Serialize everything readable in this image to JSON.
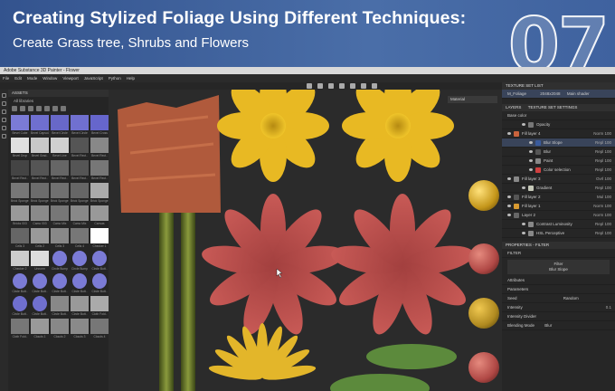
{
  "banner": {
    "title": "Creating Stylized Foliage Using Different Techniques:",
    "subtitle": "Create Grass tree, Shrubs and Flowers",
    "number": "07"
  },
  "window": {
    "title": "Adobe Substance 3D Painter - Flower"
  },
  "menu": [
    "File",
    "Edit",
    "Mode",
    "Window",
    "Viewport",
    "JavaScript",
    "Python",
    "Help"
  ],
  "assets": {
    "header": "ASSETS",
    "filter": "All libraries",
    "items": [
      "Bevel Cube",
      "Bevel Capsul..",
      "Bevel Circle",
      "Bevel Circle",
      "Bevel Cross",
      "Bevel Drop",
      "Bevel Grad..",
      "Bevel Line",
      "Bevel Rect..",
      "Bevel Rect..",
      "Bevel Rect..",
      "Bevel Rect..",
      "Bevel Rect..",
      "Bevel Rect..",
      "Bevel Rect..",
      "Brick Sponge 1",
      "Brick Sponge 2",
      "Brick Sponge 3",
      "Brick Sponge 4",
      "Brick Sponge 5",
      "Bricks 003",
      "Camo 003",
      "Camo Mix",
      "Camo Mix",
      "Canvas",
      "Cells 3",
      "Cells 2",
      "Cells 3",
      "Cells 4",
      "Checker 1",
      "Checker 2",
      "Unnorm",
      "Circle Bump",
      "Circle Bump",
      "Circle Butt..",
      "Circle Butt..",
      "Circle Butt..",
      "Circle Butt..",
      "Circle Butt..",
      "Circle Butt..",
      "Circle Butt..",
      "Circle Butt..",
      "Circle Butt..",
      "Circle Butt..",
      "Cloth Fold..",
      "Cloth Fold..",
      "Clouds 1",
      "Clouds 2",
      "Clouds 3",
      "Clouds 4"
    ]
  },
  "viewport": {
    "material_mode": "Material"
  },
  "right_panel": {
    "texture_set_list": "TEXTURE SET LIST",
    "texture_set": "M_Foliage",
    "resolution": "2048x2048",
    "shader": "Main shader",
    "tabs": [
      "LAYERS",
      "TEXTURE SET SETTINGS"
    ],
    "channel": "Base color",
    "layers": [
      {
        "name": "Opacity",
        "indent": 1,
        "right": ""
      },
      {
        "name": "Fill layer 4",
        "indent": 0,
        "right": "Norm 100"
      },
      {
        "name": "Blur Slope",
        "indent": 2,
        "right": "Repl 100"
      },
      {
        "name": "Blur",
        "indent": 2,
        "right": "Repl 100"
      },
      {
        "name": "Paint",
        "indent": 2,
        "right": "Repl 100"
      },
      {
        "name": "Color selection",
        "indent": 2,
        "right": "Repl 100"
      },
      {
        "name": "Fill layer 3",
        "indent": 0,
        "right": "Ovrl 100"
      },
      {
        "name": "Gradient",
        "indent": 1,
        "right": "Repl 100"
      },
      {
        "name": "Fill layer 2",
        "indent": 0,
        "right": "Mul 100"
      },
      {
        "name": "Fill layer 1",
        "indent": 0,
        "right": "Norm 100"
      },
      {
        "name": "Layer 2",
        "indent": 0,
        "right": "Norm 100"
      },
      {
        "name": "Contrast Luminosity",
        "indent": 1,
        "right": "Repl 100"
      },
      {
        "name": "HSL Perceptive",
        "indent": 1,
        "right": "Repl 100"
      }
    ],
    "properties_header": "PROPERTIES - FILTER",
    "filter_label": "FILTER",
    "filter_name": "Filter",
    "filter_value": "Blur Slope",
    "attributes": "Attributes",
    "parameters": "Parameters",
    "seed_label": "Seed",
    "seed_value": "Random",
    "intensity_label": "Intensity",
    "intensity_value": "0.1",
    "intensity_divider": "Intensity Divider",
    "blending_mode": "Blending Mode",
    "blending_value": "Blur"
  },
  "colors": {
    "banner": "#3f629f",
    "accent": "#f2c31c",
    "petal_red": "#b94a48",
    "stem_green": "#6a7a2a"
  }
}
